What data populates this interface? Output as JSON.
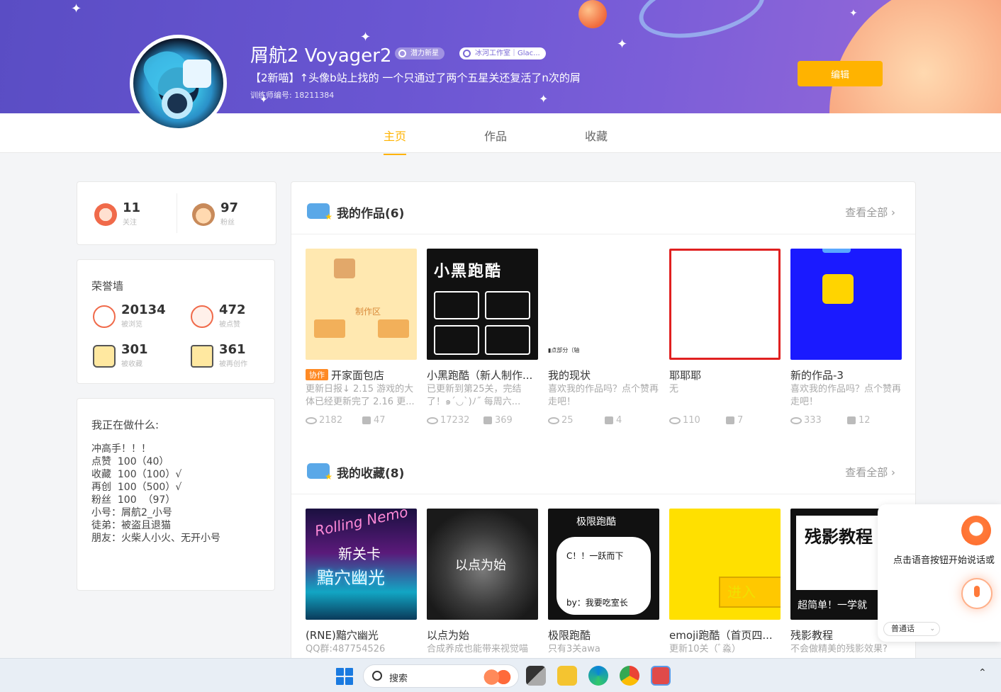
{
  "profile": {
    "username": "屑航2  Voyager2",
    "badge1": "潜力新星",
    "badge2": "冰河工作室｜Glac...",
    "bio": "【2新喵】↑头像b站上找的 一个只通过了两个五星关还复活了n次的屑",
    "trainer_id": "训练师编号: 18211384",
    "edit_label": "编辑"
  },
  "tabs": [
    "主页",
    "作品",
    "收藏"
  ],
  "follow": {
    "following": {
      "num": "11",
      "label": "关注"
    },
    "fans": {
      "num": "97",
      "label": "粉丝"
    }
  },
  "honor": {
    "title": "荣誉墙",
    "views": {
      "num": "20134",
      "label": "被浏览"
    },
    "likes": {
      "num": "472",
      "label": "被点赞"
    },
    "favorites": {
      "num": "301",
      "label": "被收藏"
    },
    "remix": {
      "num": "361",
      "label": "被再创作"
    }
  },
  "doing": {
    "title": "我正在做什么:",
    "text": "冲高手！！！\n点赞  100（40）\n收藏  100（100）√\n再创  100（500）√\n粉丝  100  （97）\n小号：屑航2_小号\n徒弟：被盗且退猫\n朋友：火柴人小火、无开小号"
  },
  "my_works": {
    "title": "我的作品(6)",
    "see_all": "查看全部",
    "items": [
      {
        "tag": "协作",
        "name": "开家面包店",
        "desc": "更新日报↓ 2.15 游戏的大体已经更新完了 2.16 更...",
        "views": "2182",
        "likes": "47"
      },
      {
        "name": "小黑跑酷（新人制作...",
        "desc": "已更新到第25关，完结了！๑ˊ◡ˋ)ﾉ˝ 每周六...",
        "views": "17232",
        "likes": "369"
      },
      {
        "name": "我的现状",
        "desc": "喜欢我的作品吗？点个赞再走吧！",
        "views": "25",
        "likes": "4"
      },
      {
        "name": "耶耶耶",
        "desc": "无",
        "views": "110",
        "likes": "7"
      },
      {
        "name": "新的作品-3",
        "desc": "喜欢我的作品吗？点个赞再走吧！",
        "views": "333",
        "likes": "12"
      }
    ]
  },
  "my_favorites": {
    "title": "我的收藏(8)",
    "see_all": "查看全部",
    "items": [
      {
        "name": "(RNE)黯穴幽光",
        "desc": "QQ群:487754526"
      },
      {
        "name": "以点为始",
        "desc": "合成养成也能带来视觉喵"
      },
      {
        "name": "极限跑酷",
        "desc": "只有3关awa"
      },
      {
        "name": "emoji跑酷（首页四...",
        "desc": "更新10关（ﾞ淼）"
      },
      {
        "name": "残影教程",
        "desc": "不会做精美的残影效果?"
      }
    ]
  },
  "thumb_text": {
    "w1_text": "制作区",
    "w2_title": "小黑跑酷",
    "w3_text": "▮点部分（轴",
    "f1_a": "Rolling Nemo",
    "f1_b": "新关卡",
    "f1_c": "黯穴幽光",
    "f2_text": "以点为始",
    "f3_title": "极限跑酷",
    "f3_a": "C！！一跃而下",
    "f3_b": "by：我要吃室长",
    "f4_text": "进入",
    "f5_title": "残影教程",
    "f5_sub": "超简单！一学就"
  },
  "voice": {
    "prompt": "点击语音按钮开始说话或",
    "mode": "普通话"
  },
  "taskbar": {
    "search": "搜索"
  },
  "colors": {
    "accent": "#ffb300",
    "banner": "#6a56d2"
  }
}
